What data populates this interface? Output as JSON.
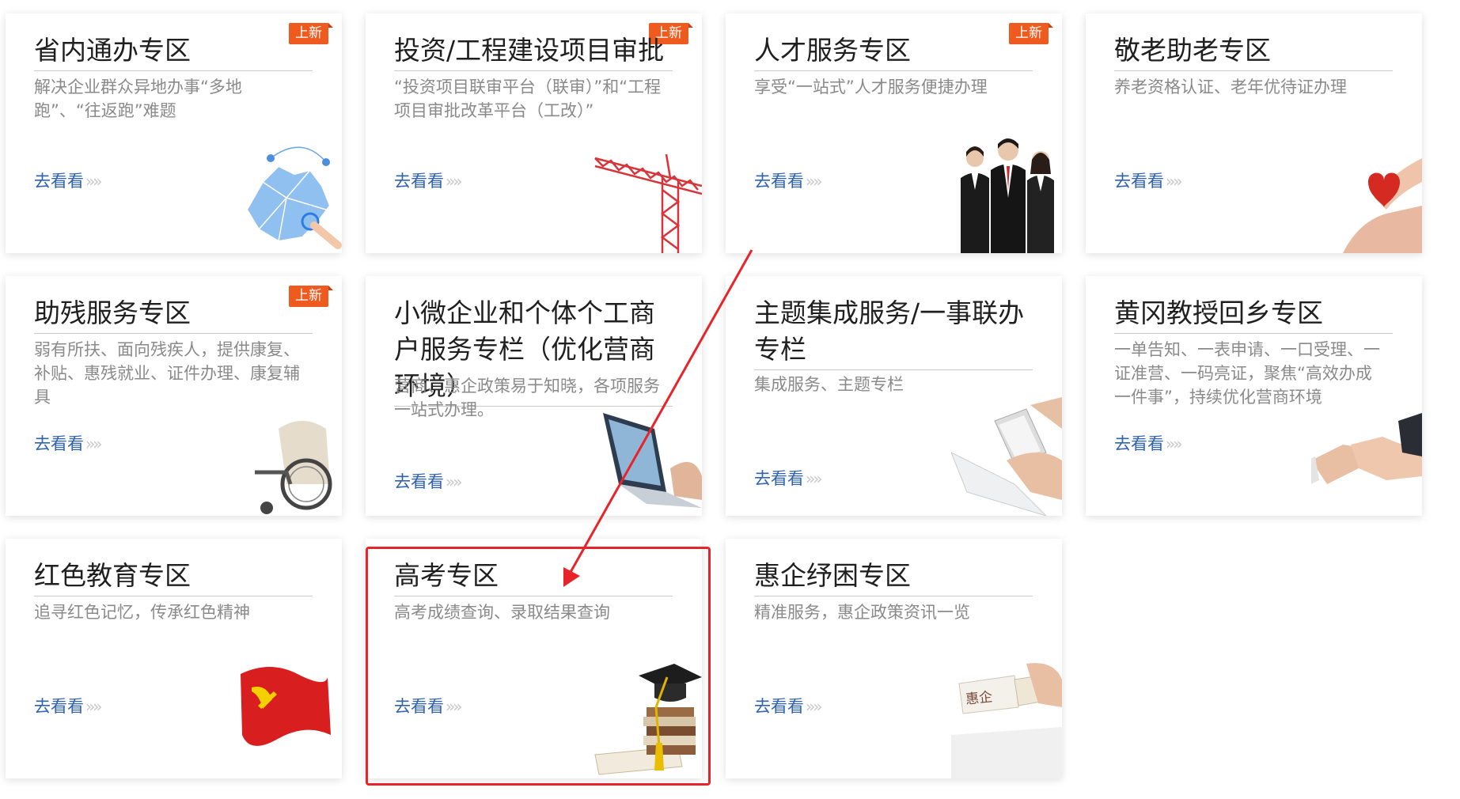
{
  "cards": [
    {
      "title": "省内通办专区",
      "desc": "解决企业群众异地办事“多地跑”、“往返跑”难题",
      "link": "去看看",
      "link_arrow": "»»",
      "badge": "上新",
      "icon": "hubei-map-icon"
    },
    {
      "title": "投资/工程建设项目审批",
      "desc": "“投资项目联审平台（联审）”和“工程项目审批改革平台（工改）”",
      "link": "去看看",
      "link_arrow": "»»",
      "badge": "上新",
      "icon": "tower-crane-icon"
    },
    {
      "title": "人才服务专区",
      "desc": "享受“一站式”人才服务便捷办理",
      "link": "去看看",
      "link_arrow": "»»",
      "badge": "上新",
      "icon": "business-people-icon"
    },
    {
      "title": "敬老助老专区",
      "desc": "养老资格认证、老年优待证办理",
      "link": "去看看",
      "link_arrow": "»»",
      "icon": "heart-hands-icon"
    },
    {
      "title": "助残服务专区",
      "desc": "弱有所扶、面向残疾人，提供康复、补贴、惠残就业、证件办理、康复辅具",
      "link": "去看看",
      "link_arrow": "»»",
      "badge": "上新",
      "icon": "wheelchair-icon"
    },
    {
      "title": "小微企业和个体个工商户服务专栏（优化营商环境）",
      "desc": "营商、惠企政策易于知晓，各项服务一站式办理。",
      "link": "去看看",
      "link_arrow": "»»",
      "icon": "laptop-icon"
    },
    {
      "title": "主题集成服务/一事联办专栏",
      "desc": "集成服务、主题专栏",
      "link": "去看看",
      "link_arrow": "»»",
      "icon": "phone-hands-icon"
    },
    {
      "title": "黄冈教授回乡专区",
      "desc": "一单告知、一表申请、一口受理、一证准营、一码亮证，聚焦“高效办成一件事”，持续优化营商环境",
      "link": "去看看",
      "link_arrow": "»»",
      "icon": "handshake-icon"
    },
    {
      "title": "红色教育专区",
      "desc": "追寻红色记忆，传承红色精神",
      "link": "去看看",
      "link_arrow": "»»",
      "icon": "party-flag-icon"
    },
    {
      "title": "高考专区",
      "desc": "高考成绩查询、录取结果查询",
      "link": "去看看",
      "link_arrow": "»»",
      "icon": "graduation-cap-books-icon"
    },
    {
      "title": "惠企纾困专区",
      "desc": "精准服务，惠企政策资讯一览",
      "link": "去看看",
      "link_arrow": "»»",
      "icon": "seal-stamp-icon",
      "stamp_text": "惠企"
    }
  ],
  "colors": {
    "badge": "#ef5b1e",
    "link": "#2f62b5",
    "highlight": "#e8232a",
    "title": "#1f1f1f",
    "desc": "#8a8a8a"
  }
}
